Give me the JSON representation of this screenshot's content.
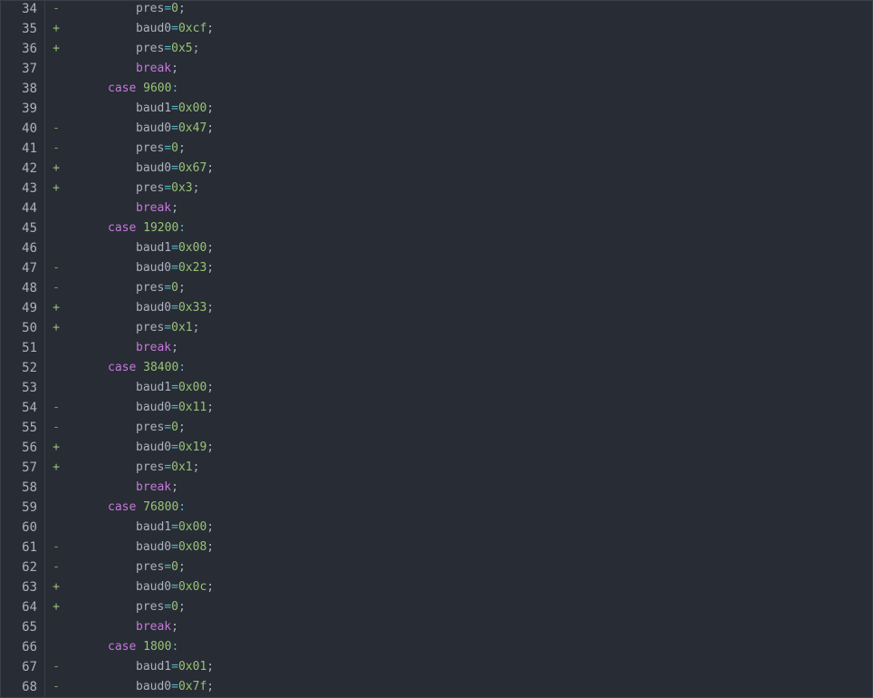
{
  "editor": {
    "lines": [
      {
        "n": "34",
        "m": "-",
        "kind": "assign",
        "name": "pres",
        "value": "0"
      },
      {
        "n": "35",
        "m": "+",
        "kind": "assign",
        "name": "baud0",
        "value": "0xcf"
      },
      {
        "n": "36",
        "m": "+",
        "kind": "assign",
        "name": "pres",
        "value": "0x5"
      },
      {
        "n": "37",
        "m": "",
        "kind": "break",
        "kw": "break"
      },
      {
        "n": "38",
        "m": "",
        "kind": "case",
        "kw": "case",
        "value": "9600"
      },
      {
        "n": "39",
        "m": "",
        "kind": "assign",
        "name": "baud1",
        "value": "0x00"
      },
      {
        "n": "40",
        "m": "-",
        "kind": "assign",
        "name": "baud0",
        "value": "0x47"
      },
      {
        "n": "41",
        "m": "-",
        "kind": "assign",
        "name": "pres",
        "value": "0"
      },
      {
        "n": "42",
        "m": "+",
        "kind": "assign",
        "name": "baud0",
        "value": "0x67"
      },
      {
        "n": "43",
        "m": "+",
        "kind": "assign",
        "name": "pres",
        "value": "0x3"
      },
      {
        "n": "44",
        "m": "",
        "kind": "break",
        "kw": "break"
      },
      {
        "n": "45",
        "m": "",
        "kind": "case",
        "kw": "case",
        "value": "19200"
      },
      {
        "n": "46",
        "m": "",
        "kind": "assign",
        "name": "baud1",
        "value": "0x00"
      },
      {
        "n": "47",
        "m": "-",
        "kind": "assign",
        "name": "baud0",
        "value": "0x23"
      },
      {
        "n": "48",
        "m": "-",
        "kind": "assign",
        "name": "pres",
        "value": "0"
      },
      {
        "n": "49",
        "m": "+",
        "kind": "assign",
        "name": "baud0",
        "value": "0x33"
      },
      {
        "n": "50",
        "m": "+",
        "kind": "assign",
        "name": "pres",
        "value": "0x1"
      },
      {
        "n": "51",
        "m": "",
        "kind": "break",
        "kw": "break"
      },
      {
        "n": "52",
        "m": "",
        "kind": "case",
        "kw": "case",
        "value": "38400"
      },
      {
        "n": "53",
        "m": "",
        "kind": "assign",
        "name": "baud1",
        "value": "0x00"
      },
      {
        "n": "54",
        "m": "-",
        "kind": "assign",
        "name": "baud0",
        "value": "0x11"
      },
      {
        "n": "55",
        "m": "-",
        "kind": "assign",
        "name": "pres",
        "value": "0"
      },
      {
        "n": "56",
        "m": "+",
        "kind": "assign",
        "name": "baud0",
        "value": "0x19"
      },
      {
        "n": "57",
        "m": "+",
        "kind": "assign",
        "name": "pres",
        "value": "0x1"
      },
      {
        "n": "58",
        "m": "",
        "kind": "break",
        "kw": "break"
      },
      {
        "n": "59",
        "m": "",
        "kind": "case",
        "kw": "case",
        "value": "76800"
      },
      {
        "n": "60",
        "m": "",
        "kind": "assign",
        "name": "baud1",
        "value": "0x00"
      },
      {
        "n": "61",
        "m": "-",
        "kind": "assign",
        "name": "baud0",
        "value": "0x08"
      },
      {
        "n": "62",
        "m": "-",
        "kind": "assign",
        "name": "pres",
        "value": "0"
      },
      {
        "n": "63",
        "m": "+",
        "kind": "assign",
        "name": "baud0",
        "value": "0x0c"
      },
      {
        "n": "64",
        "m": "+",
        "kind": "assign",
        "name": "pres",
        "value": "0"
      },
      {
        "n": "65",
        "m": "",
        "kind": "break",
        "kw": "break"
      },
      {
        "n": "66",
        "m": "",
        "kind": "case",
        "kw": "case",
        "value": "1800"
      },
      {
        "n": "67",
        "m": "-",
        "kind": "assign",
        "name": "baud1",
        "value": "0x01"
      },
      {
        "n": "68",
        "m": "-",
        "kind": "assign",
        "name": "baud0",
        "value": "0x7f"
      }
    ]
  },
  "syntax": {
    "equals": "=",
    "semicolon": ";",
    "colon": ":"
  },
  "colors": {
    "background": "#282c34",
    "line_number": "#abb2bf",
    "keyword": "#c678dd",
    "number": "#98c379",
    "operator": "#56b6c2",
    "identifier": "#abb2bf",
    "diff_marker": "#98c379"
  }
}
